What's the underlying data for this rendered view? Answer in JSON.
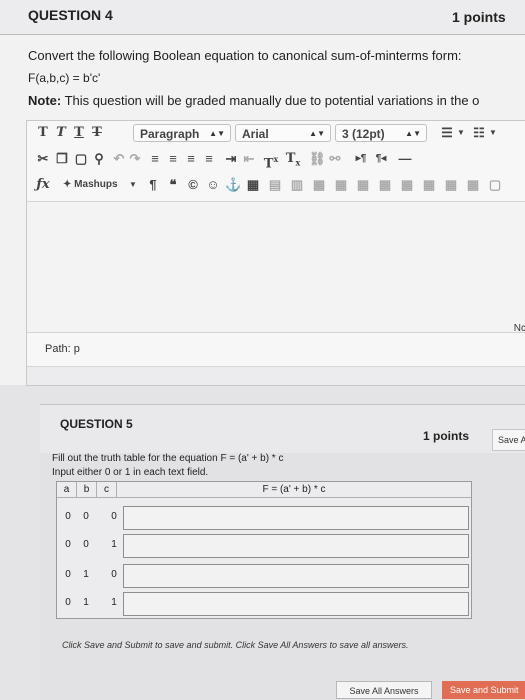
{
  "question4": {
    "title": "QUESTION 4",
    "points": "1 points",
    "prompt": "Convert the following Boolean equation to canonical sum-of-minterms form:",
    "equation": "F(a,b,c) = b'c'",
    "note_label": "Note:",
    "note_text": " This question will be graded manually due to potential variations in the o"
  },
  "editor": {
    "paragraph_select": "Paragraph",
    "font_select": "Arial",
    "size_select": "3 (12pt)",
    "mashups_label": "Mashups",
    "path_label": "Path: p",
    "words_label": "Nc"
  },
  "question5": {
    "title": "QUESTION 5",
    "points": "1 points",
    "save_label": "Save A",
    "instruction_1": "Fill out the truth table for the equation F = (a' + b) * c",
    "instruction_2": "Input either 0 or 1 in each text field.",
    "table": {
      "headers": [
        "a",
        "b",
        "c",
        "F = (a' + b) * c"
      ],
      "rows": [
        [
          "0",
          "0",
          "0"
        ],
        [
          "0",
          "0",
          "1"
        ],
        [
          "0",
          "1",
          "0"
        ],
        [
          "0",
          "1",
          "1"
        ]
      ]
    }
  },
  "footer": {
    "note": "Click Save and Submit to save and submit. Click Save All Answers to save all answers.",
    "save_all_label": "Save All Answers",
    "submit_label": "Save and Submit"
  },
  "colors": {
    "submit": "#e16d55",
    "page_bg": "#e4e4e6"
  }
}
